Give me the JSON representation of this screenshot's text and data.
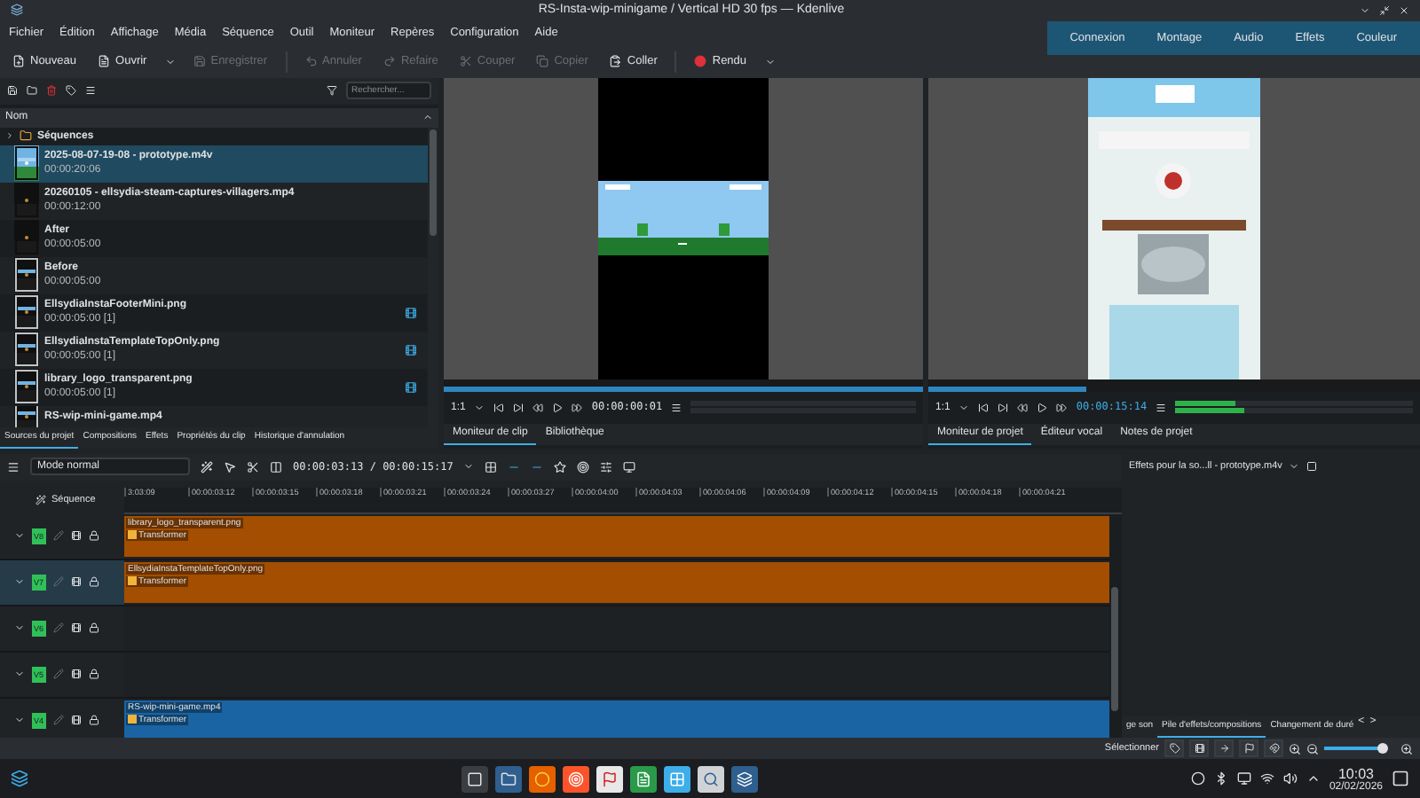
{
  "window": {
    "title": "RS-Insta-wip-minigame / Vertical HD 30 fps — Kdenlive"
  },
  "menu": [
    "Fichier",
    "Édition",
    "Affichage",
    "Média",
    "Séquence",
    "Outil",
    "Moniteur",
    "Repères",
    "Configuration",
    "Aide"
  ],
  "workspaces": [
    {
      "label": "Connexion",
      "selected": false
    },
    {
      "label": "Montage",
      "selected": false
    },
    {
      "label": "Audio",
      "selected": false
    },
    {
      "label": "Effets",
      "selected": false
    },
    {
      "label": "Couleur",
      "selected": false
    }
  ],
  "toolbar": [
    {
      "label": "Nouveau",
      "disabled": false,
      "dropdown": false
    },
    {
      "label": "Ouvrir",
      "disabled": false,
      "dropdown": true
    },
    {
      "label": "Enregistrer",
      "disabled": true,
      "dropdown": false
    },
    {
      "label": "Annuler",
      "disabled": true,
      "dropdown": false
    },
    {
      "label": "Refaire",
      "disabled": true,
      "dropdown": false
    },
    {
      "label": "Couper",
      "disabled": true,
      "dropdown": false
    },
    {
      "label": "Copier",
      "disabled": true,
      "dropdown": false
    },
    {
      "label": "Coller",
      "disabled": false,
      "dropdown": false
    },
    {
      "label": "Rendu",
      "disabled": false,
      "dropdown": true
    }
  ],
  "bin": {
    "search": {
      "placeholder": "Rechercher..."
    },
    "column": "Nom",
    "items": [
      {
        "kind": "folder",
        "name": "Séquences",
        "selected": false
      },
      {
        "kind": "clip",
        "name": "2025-08-07-19-08 - prototype.m4v",
        "duration": "00:00:20:06",
        "selected": true,
        "proxy": false
      },
      {
        "kind": "clip",
        "name": "20260105 - ellsydia-steam-captures-villagers.mp4",
        "duration": "00:00:12:00",
        "selected": false,
        "proxy": false
      },
      {
        "kind": "clip",
        "name": "After",
        "duration": "00:00:05:00",
        "selected": false,
        "proxy": false
      },
      {
        "kind": "clip",
        "name": "Before",
        "duration": "00:00:05:00",
        "selected": false,
        "proxy": false
      },
      {
        "kind": "clip",
        "name": "EllsydiaInstaFooterMini.png",
        "duration": "00:00:05:00 [1]",
        "selected": false,
        "proxy": true
      },
      {
        "kind": "clip",
        "name": "EllsydiaInstaTemplateTopOnly.png",
        "duration": "00:00:05:00 [1]",
        "selected": false,
        "proxy": true
      },
      {
        "kind": "clip",
        "name": "library_logo_transparent.png",
        "duration": "00:00:05:00 [1]",
        "selected": false,
        "proxy": true
      },
      {
        "kind": "clip",
        "name": "RS-wip-mini-game.mp4",
        "selected": false,
        "proxy": false
      }
    ],
    "tabs": [
      {
        "label": "Sources du projet",
        "selected": true
      },
      {
        "label": "Compositions",
        "selected": false
      },
      {
        "label": "Effets",
        "selected": false
      },
      {
        "label": "Propriétés du clip",
        "selected": false
      },
      {
        "label": "Historique d'annulation",
        "selected": false
      }
    ]
  },
  "clip_monitor": {
    "zoom": "1:1",
    "timecode": "00:00:00:01",
    "position": {
      "level": 1
    },
    "tabs": [
      {
        "label": "Moniteur de clip",
        "selected": true
      },
      {
        "label": "Bibliothèque",
        "selected": false
      }
    ]
  },
  "project_monitor": {
    "zoom": "1:1",
    "timecode": "00:00:15:14",
    "position": {
      "level": 0.32
    },
    "meters": [
      {
        "level": 0.25
      },
      {
        "level": 0.29
      }
    ],
    "tabs": [
      {
        "label": "Moniteur de projet",
        "selected": true
      },
      {
        "label": "Éditeur vocal",
        "selected": false
      },
      {
        "label": "Notes de projet",
        "selected": false
      }
    ]
  },
  "timeline": {
    "mode": "Mode normal",
    "timecode": "00:00:03:13 / 00:00:15:17",
    "sequence_label": "Séquence",
    "ruler": [
      "3:03:09",
      "00:00:03:12",
      "00:00:03:15",
      "00:00:03:18",
      "00:00:03:21",
      "00:00:03:24",
      "00:00:03:27",
      "00:00:04:00",
      "00:00:04:03",
      "00:00:04:06",
      "00:00:04:09",
      "00:00:04:12",
      "00:00:04:15",
      "00:00:04:18",
      "00:00:04:21"
    ],
    "tracks": [
      {
        "label": "V8",
        "selected": false,
        "clip": {
          "name": "library_logo_transparent.png",
          "effect": "Transformer",
          "color": "#a34e00"
        }
      },
      {
        "label": "V7",
        "selected": true,
        "clip": {
          "name": "EllsydiaInstaTemplateTopOnly.png",
          "effect": "Transformer",
          "color": "#a34e00"
        }
      },
      {
        "label": "V6",
        "selected": false
      },
      {
        "label": "V5",
        "selected": false
      },
      {
        "label": "V4",
        "selected": false,
        "clip": {
          "name": "RS-wip-mini-game.mp4",
          "effect": "Transformer",
          "color": "#1a64a4"
        }
      }
    ]
  },
  "effects_panel": {
    "title": "Effets pour la so...ll - prototype.m4v",
    "tabs": [
      {
        "label": "ge son",
        "selected": false
      },
      {
        "label": "Pile d'effets/compositions",
        "selected": true
      },
      {
        "label": "Changement de duré",
        "selected": false
      }
    ],
    "scroll_left": "<",
    "scroll_right": ">"
  },
  "status_bar": {
    "label": "Sélectionner",
    "zoom": {
      "level": 0.82
    }
  },
  "taskbar": {
    "time": "10:03",
    "date": "02/02/2026"
  }
}
